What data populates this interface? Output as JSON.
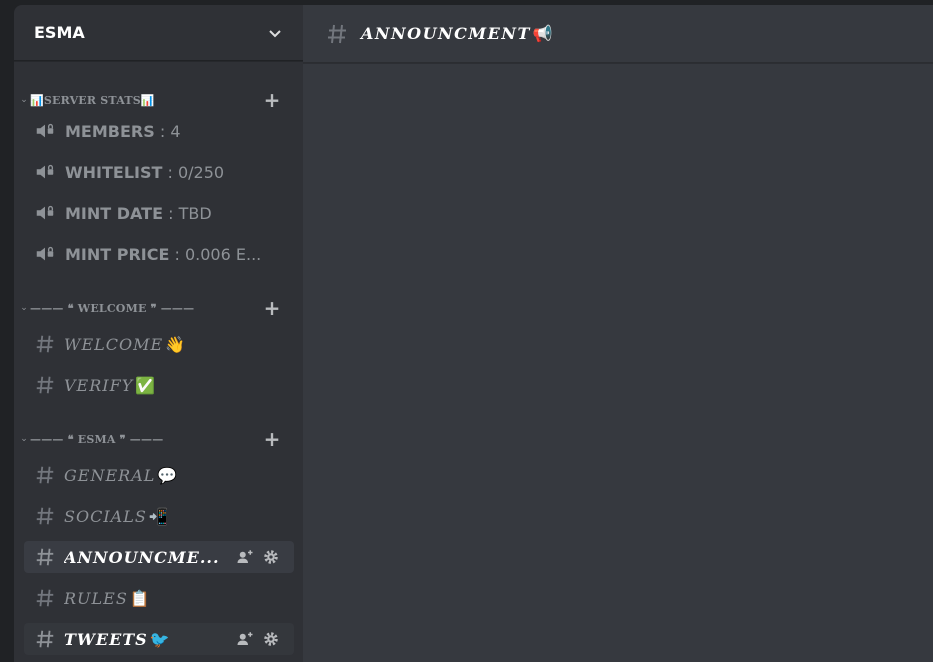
{
  "server": {
    "name": "ESMA"
  },
  "categories": [
    {
      "label": "📊SERVER STATS📊",
      "voice_channels": [
        {
          "name": "MEMBERS",
          "value": " : 4"
        },
        {
          "name": "WHITELIST",
          "value": " : 0/250"
        },
        {
          "name": "MINT DATE",
          "value": " : TBD"
        },
        {
          "name": "MINT PRICE",
          "value": " : 0.006 E..."
        }
      ]
    },
    {
      "label": "——— ❝ WELCOME ❞ ———",
      "channels": [
        {
          "name": "WELCOME",
          "emoji": "👋"
        },
        {
          "name": "VERIFY",
          "emoji": "✅"
        }
      ]
    },
    {
      "label": "——— ❝ ESMA ❞ ———",
      "channels": [
        {
          "name": "GENERAL",
          "emoji": "💬"
        },
        {
          "name": "SOCIALS",
          "emoji": "📲"
        },
        {
          "name": "ANNOUNCME..."
        },
        {
          "name": "RULES",
          "emoji": "📋"
        },
        {
          "name": "TWEETS",
          "emoji": "🐦"
        }
      ]
    }
  ],
  "main": {
    "title": "ANNOUNCMENT",
    "title_emoji": "📢"
  },
  "colors": {
    "sidebar_bg": "#2f3136",
    "main_bg": "#36393f",
    "muted_text": "#8e9297",
    "selected_bg": "#393c43"
  }
}
